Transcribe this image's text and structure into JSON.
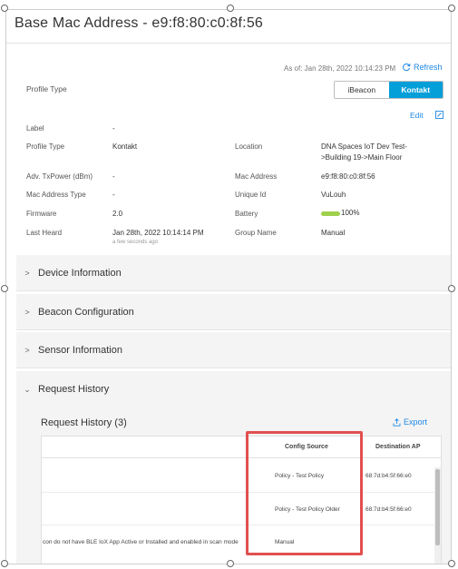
{
  "header": {
    "title": "Base Mac Address - e9:f8:80:c0:8f:56"
  },
  "status": {
    "as_of": "As of: Jan 28th, 2022 10:14:23 PM",
    "refresh_label": "Refresh"
  },
  "profile": {
    "label": "Profile Type",
    "options": [
      "iBeacon",
      "Kontakt"
    ],
    "selected": "Kontakt"
  },
  "edit_label": "Edit",
  "details": {
    "label": {
      "label": "Label",
      "value": "-"
    },
    "profile_type": {
      "label": "Profile Type",
      "value": "Kontakt"
    },
    "location": {
      "label": "Location",
      "value_line1": "DNA Spaces IoT Dev Test-",
      "value_line2": ">Building 19->Main Floor"
    },
    "tx_power": {
      "label": "Adv. TxPower (dBm)",
      "value": "-"
    },
    "mac_address": {
      "label": "Mac Address",
      "value": "e9:f8:80:c0:8f:56"
    },
    "mac_type": {
      "label": "Mac Address Type",
      "value": "-"
    },
    "unique_id": {
      "label": "Unique Id",
      "value": "VuLouh"
    },
    "firmware": {
      "label": "Firmware",
      "value": "2.0"
    },
    "battery": {
      "label": "Battery",
      "value": "100%",
      "level": 1.0,
      "color": "#9fd04b"
    },
    "last_heard": {
      "label": "Last Heard",
      "value": "Jan 28th, 2022 10:14:14 PM",
      "sub": "a few seconds ago"
    },
    "group_name": {
      "label": "Group Name",
      "value": "Manual"
    }
  },
  "sections": [
    {
      "label": "Device Information",
      "expanded": false
    },
    {
      "label": "Beacon Configuration",
      "expanded": false
    },
    {
      "label": "Sensor Information",
      "expanded": false
    },
    {
      "label": "Request History",
      "expanded": true
    }
  ],
  "request_history": {
    "title": "Request History (3)",
    "export_label": "Export",
    "columns": {
      "config_source": "Config Source",
      "destination_ap": "Destination AP"
    },
    "rows": [
      {
        "message": "",
        "config_source": "Policy - Test Policy",
        "destination_ap": "68:7d:b4:5f:66:e0"
      },
      {
        "message": "",
        "config_source": "Policy - Test Policy Older",
        "destination_ap": "68:7d:b4:5f:66:e0"
      },
      {
        "message": "con do not have BLE IoX App Active or Installed and enabled in scan mode",
        "config_source": "Manual",
        "destination_ap": ""
      }
    ]
  },
  "colors": {
    "accent": "#049fd9",
    "link": "#1e88e5",
    "highlight": "#e0504f"
  },
  "icons": {
    "refresh": "refresh-icon",
    "edit": "edit-icon",
    "export": "export-icon",
    "chevron_right": "chevron-right-icon",
    "chevron_down": "chevron-down-icon"
  }
}
